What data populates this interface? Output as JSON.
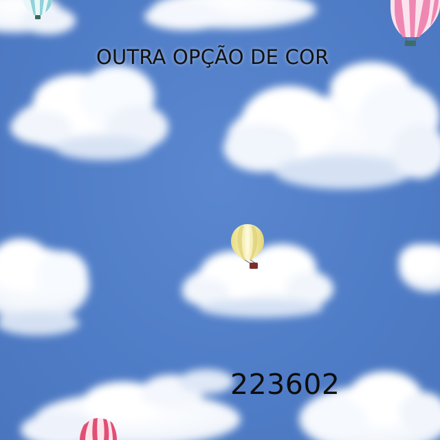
{
  "caption": "OUTRA OPÇÃO DE COR",
  "product_code": "223602",
  "colors": {
    "sky": "#5580c9",
    "cloud": "#ffffff",
    "balloon_pink": "#f08cb4",
    "balloon_yellow": "#f6eda0",
    "balloon_teal": "#8fd2d8"
  }
}
